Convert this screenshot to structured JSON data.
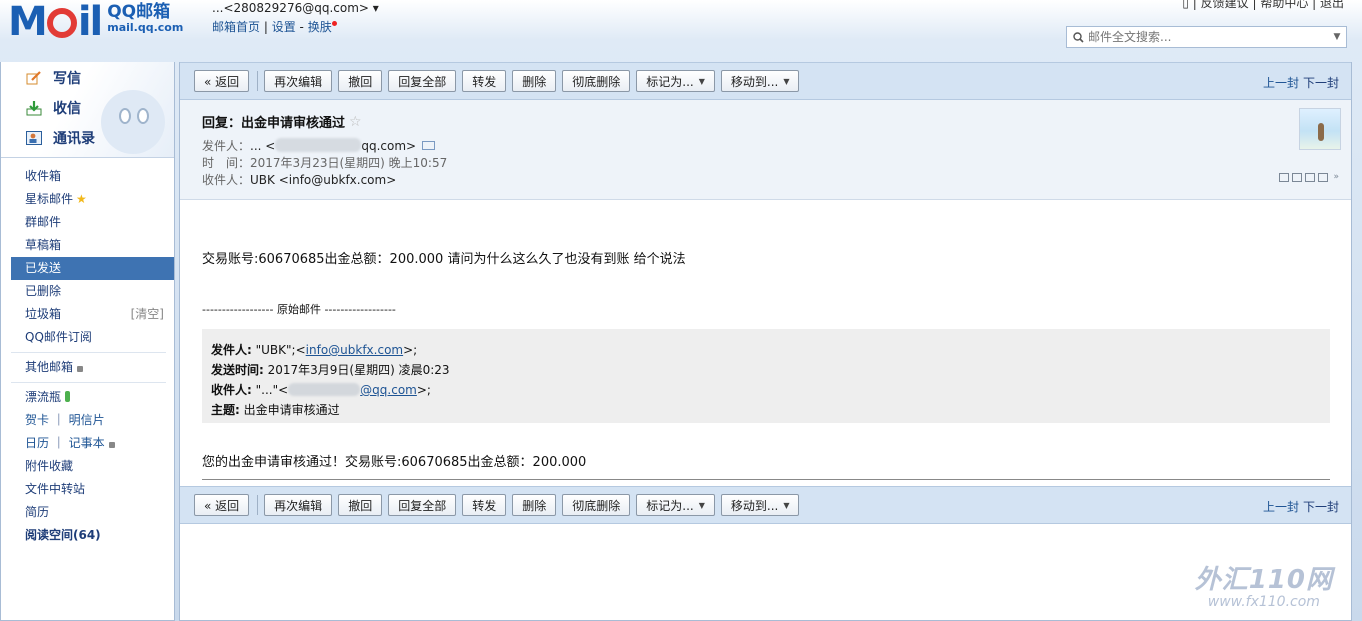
{
  "header": {
    "logo_title": "QQ邮箱",
    "logo_url": "mail.qq.com",
    "account_email": "...<280829276@qq.com> ▾",
    "account_links": [
      "邮箱首页",
      "设置",
      "换肤"
    ],
    "top_links": "▯ | 反馈建议 | 帮助中心 | 退出",
    "search_placeholder": "邮件全文搜索..."
  },
  "sidebar": {
    "top_actions": [
      {
        "label": "写信",
        "icon": "pencil-icon"
      },
      {
        "label": "收信",
        "icon": "inbox-download-icon"
      },
      {
        "label": "通讯录",
        "icon": "contacts-icon"
      }
    ],
    "folders": [
      {
        "label": "收件箱"
      },
      {
        "label": "星标邮件"
      },
      {
        "label": "群邮件"
      },
      {
        "label": "草稿箱"
      },
      {
        "label": "已发送",
        "active": true
      },
      {
        "label": "已删除"
      },
      {
        "label": "垃圾箱",
        "extra": "[清空]"
      },
      {
        "label": "QQ邮件订阅"
      }
    ],
    "other_mailbox": "其他邮箱",
    "apps": [
      "漂流瓶",
      "贺卡",
      "明信片",
      "日历",
      "记事本",
      "附件收藏",
      "文件中转站",
      "简历",
      "阅读空间(64)"
    ]
  },
  "toolbar": {
    "back": "« 返回",
    "buttons": [
      "再次编辑",
      "撤回",
      "回复全部",
      "转发",
      "删除",
      "彻底删除"
    ],
    "mark_as": "标记为...",
    "move_to": "移动到...",
    "prev": "上一封",
    "next": "下一封"
  },
  "mail": {
    "subject": "回复：出金申请审核通过",
    "from_label": "发件人：",
    "from_prefix": "... <",
    "from_suffix": "qq.com>",
    "time_label": "时　间：",
    "time_value": "2017年3月23日(星期四) 晚上10:57",
    "to_label": "收件人：",
    "to_value": "UBK <info@ubkfx.com>",
    "body_line": "交易账号:60670685出金总额：200.000  请问为什么这么久了也没有到账 给个说法",
    "orig_separator": "------------------ 原始邮件 ------------------",
    "quote": {
      "from_label": "发件人:",
      "from_name": " \"UBK\";<",
      "from_email": "info@ubkfx.com",
      "from_end": ">;",
      "sent_label": "发送时间:",
      "sent_value": " 2017年3月9日(星期四) 凌晨0:23",
      "to_label": "收件人:",
      "to_prefix": " \"...\"<",
      "to_email_suffix": "@qq.com",
      "to_end": ">;",
      "subject_label": "主题:",
      "subject_value": " 出金申请审核通过"
    },
    "reply_line": "您的出金申请审核通过！交易账号:60670685出金总额：200.000"
  },
  "watermark": {
    "big": "外汇110网",
    "small": "www.fx110.com"
  },
  "colors": {
    "brand_blue": "#1b5fb3",
    "active_folder": "#3e73b2",
    "toolbar_bg": "#d4e3f3"
  }
}
